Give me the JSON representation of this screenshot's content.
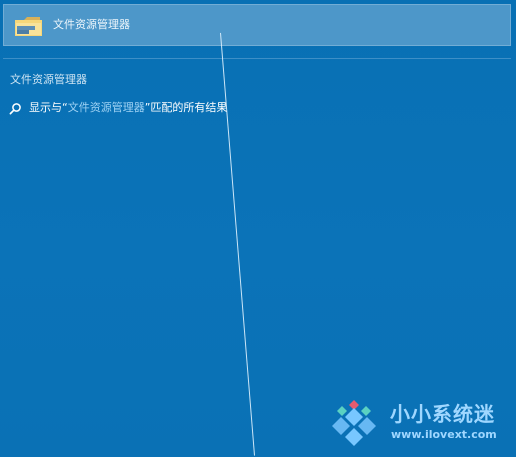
{
  "top_result": {
    "icon": "folder-icon",
    "label": "文件资源管理器"
  },
  "section": {
    "label": "文件资源管理器"
  },
  "web_result": {
    "icon": "search-icon",
    "prefix": "显示与“",
    "query": "文件资源管理器",
    "suffix": "”匹配的所有结果"
  },
  "watermark": {
    "title": "小小系统迷",
    "url": "www.ilovext.com"
  },
  "colors": {
    "background": "#0a73b7",
    "highlight": "#4d97c9",
    "query": "#9fd2f4"
  }
}
